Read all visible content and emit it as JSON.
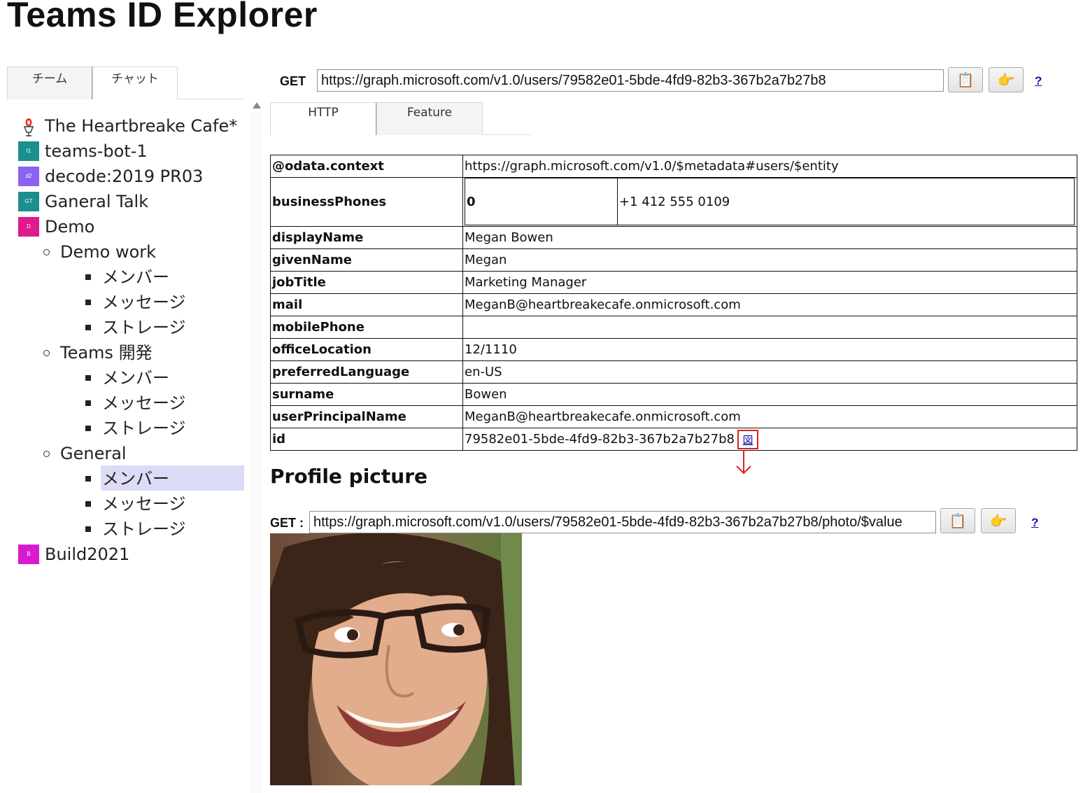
{
  "app": {
    "title": "Teams ID Explorer"
  },
  "left_tabs": [
    "チーム",
    "チャット"
  ],
  "tree": {
    "teams": [
      {
        "label": "The Heartbreake Cafe*",
        "icon": "heartbreake-cafe-icon",
        "color": ""
      },
      {
        "label": "teams-bot-1",
        "icon": "t1",
        "color": "#1b8e8e"
      },
      {
        "label": "decode:2019 PR03",
        "icon": "d2",
        "color": "#8a63f2"
      },
      {
        "label": "Ganeral Talk",
        "icon": "GT",
        "color": "#1b8e8e"
      },
      {
        "label": "Demo",
        "icon": "D",
        "color": "#e0198c"
      },
      {
        "label": "Build2021",
        "icon": "B",
        "color": "#d81bcf"
      }
    ],
    "channels": [
      "Demo work",
      "Teams 開発",
      "General"
    ],
    "subitems": [
      "メンバー",
      "メッセージ",
      "ストレージ"
    ]
  },
  "request": {
    "label": "GET",
    "url": "https://graph.microsoft.com/v1.0/users/79582e01-5bde-4fd9-82b3-367b2a7b27b8",
    "copy_icon": "clipboard-icon",
    "go_icon": "pointing-hand-icon",
    "help": "?"
  },
  "result_tabs": [
    "HTTP",
    "Feature"
  ],
  "properties": [
    {
      "key": "@odata.context",
      "value": "https://graph.microsoft.com/v1.0/$metadata#users/$entity"
    },
    {
      "key": "businessPhones",
      "index": "0",
      "value": "+1 412 555 0109"
    },
    {
      "key": "displayName",
      "value": "Megan Bowen"
    },
    {
      "key": "givenName",
      "value": "Megan"
    },
    {
      "key": "jobTitle",
      "value": "Marketing Manager"
    },
    {
      "key": "mail",
      "value": "MeganB@heartbreakecafe.onmicrosoft.com"
    },
    {
      "key": "mobilePhone",
      "value": ""
    },
    {
      "key": "officeLocation",
      "value": "12/1110"
    },
    {
      "key": "preferredLanguage",
      "value": "en-US"
    },
    {
      "key": "surname",
      "value": "Bowen"
    },
    {
      "key": "userPrincipalName",
      "value": "MeganB@heartbreakecafe.onmicrosoft.com"
    },
    {
      "key": "id",
      "value": "79582e01-5bde-4fd9-82b3-367b2a7b27b8",
      "link": "図"
    }
  ],
  "profile": {
    "heading": "Profile picture",
    "label": "GET :",
    "url": "https://graph.microsoft.com/v1.0/users/79582e01-5bde-4fd9-82b3-367b2a7b27b8/photo/$value",
    "help": "?"
  },
  "colors": {
    "selection": "#dcdcf7",
    "annotation": "#e02020",
    "link": "#1a0dab"
  }
}
